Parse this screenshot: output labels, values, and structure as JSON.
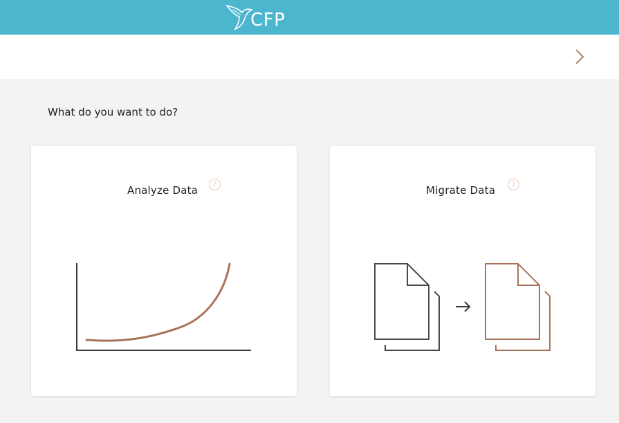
{
  "header": {
    "logo_text": "CFP",
    "brand_color": "#4db6cf"
  },
  "nav": {
    "next_icon": "chevron-right-icon",
    "accent_color": "#b07d62"
  },
  "main": {
    "prompt": "What do you want to do?",
    "cards": [
      {
        "title": "Analyze Data",
        "help_icon": "question-circle-icon",
        "help_glyph": "?"
      },
      {
        "title": "Migrate Data",
        "help_icon": "question-circle-icon",
        "help_glyph": "?"
      }
    ]
  }
}
